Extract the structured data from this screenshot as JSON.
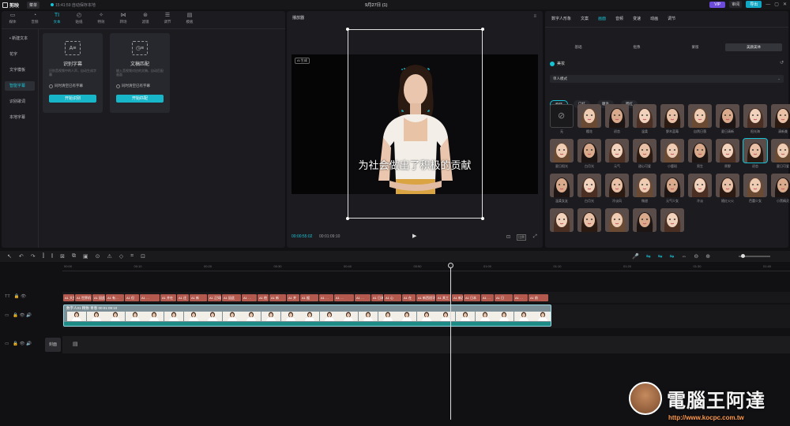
{
  "app": {
    "name": "剪映",
    "menu": "菜单",
    "autosave": "15:41:59 自动保存本地",
    "project_title": "9月27日 (1)",
    "vip": "VIP",
    "share": "审阅",
    "export": "导出",
    "min": "—",
    "max": "▢",
    "close": "✕"
  },
  "toolbar": {
    "tabs": [
      {
        "label": "媒体",
        "icon": "media-icon",
        "glyph": "▭"
      },
      {
        "label": "音频",
        "icon": "audio-icon",
        "glyph": "◔"
      },
      {
        "label": "文本",
        "icon": "text-icon",
        "glyph": "TI"
      },
      {
        "label": "贴纸",
        "icon": "sticker-icon",
        "glyph": "◴"
      },
      {
        "label": "特效",
        "icon": "effects-icon",
        "glyph": "✧"
      },
      {
        "label": "转场",
        "icon": "transition-icon",
        "glyph": "⋈"
      },
      {
        "label": "滤镜",
        "icon": "filter-icon",
        "glyph": "⊛"
      },
      {
        "label": "调节",
        "icon": "adjust-icon",
        "glyph": "☰"
      },
      {
        "label": "模板",
        "icon": "template-icon",
        "glyph": "▤"
      }
    ],
    "active": 2
  },
  "sidebar": {
    "items": [
      "• 新建文本",
      "花字",
      "文字模板",
      "智能字幕",
      "识别歌词",
      "本地字幕"
    ],
    "active": 3
  },
  "cards": [
    {
      "title": "识别字幕",
      "desc": "识别音视频中的人声，自动生成字幕",
      "check": "同时清空已有字幕",
      "button": "开始识别",
      "icon": "A≡"
    },
    {
      "title": "文稿匹配",
      "desc": "输入音视频对应的文稿，自动匹配画面",
      "check": "同时清空已有字幕",
      "button": "开始匹配",
      "icon": "◷≡"
    }
  ],
  "player": {
    "title": "播放器",
    "menu": "≡",
    "badge": "AI 生成",
    "subtitle": "为社会做出了积极的贡献",
    "current": "00:00:55:02",
    "total": "00:01:09:10",
    "play": "▶",
    "ratio": "比例"
  },
  "right": {
    "tabs": [
      "数字人形象",
      "文案",
      "画面",
      "音频",
      "变速",
      "动画",
      "调节"
    ],
    "active_tab": 2,
    "subtabs": [
      "基础",
      "抠像",
      "蒙版",
      "美颜美体"
    ],
    "active_sub": 3,
    "beauty": {
      "label": "美妆",
      "reset": "↺",
      "dropdown": "单人模式",
      "chips": [
        "套装",
        "口红",
        "睫毛",
        "腮红"
      ],
      "active_chip": 0
    },
    "thumbs": [
      "无",
      "樱花",
      "初恋",
      "温柔",
      "野木蓝莓",
      "自然日落",
      "夏日清新",
      "阳光海",
      "清新美",
      "夏日阳光",
      "白月光",
      "元气",
      "甜心可爱",
      "小鹿斑",
      "男生",
      "原野",
      "初恋",
      "夏日可爱",
      "温柔女友",
      "白月光",
      "冷淡风",
      "微甜",
      "元气少女",
      "冷淡",
      "随红火火",
      "芭蕾少女",
      "小黑精灵",
      "anime",
      "大气",
      "冬日清新",
      "学院派",
      "人物低胸"
    ],
    "selected_thumb": 16
  },
  "timeline": {
    "tools": [
      "↖",
      "↶",
      "↷",
      "⫿",
      "⫾",
      "⊠",
      "⧉",
      "▣",
      "⊙",
      "⚠",
      "◇",
      "⌗",
      "⊡"
    ],
    "right_tools": [
      "🎤",
      "⇋",
      "⇋",
      "⇋",
      "⇔",
      "⊖",
      "⊕"
    ],
    "ticks": [
      "00:00",
      "00:10",
      "00:20",
      "00:30",
      "00:40",
      "00:50",
      "01:00",
      "01:10",
      "01:20",
      "01:30",
      "01:40"
    ],
    "tracks": [
      {
        "label": "TT",
        "locks": "🔒 👁"
      },
      {
        "label": "▭",
        "locks": "🔒 👁 🔊"
      },
      {
        "label": "▭",
        "locks": "🔒 👁 🔊"
      }
    ],
    "text_clips": [
      "A1 大多",
      "A1 世界机",
      "A1 因此新",
      "A1 有…",
      "A1 但",
      "A1 …",
      "A1 并在",
      "A1 还",
      "A1 新",
      "A1 正如民",
      "A1 因此",
      "A1 …",
      "A1 他",
      "A1 新",
      "A1 并",
      "A1 据",
      "A1 …",
      "A1 …",
      "A1 …",
      "A1 日本",
      "A1 心",
      "A1 在",
      "A1 新西班牙",
      "A1 其工",
      "A1 新西兰",
      "A1 日本",
      "A1 …",
      "A1 日",
      "A1 …",
      "A1 前",
      "A1 …",
      "A1 在",
      "A1 不仅",
      "A1 …"
    ],
    "video_clip": "数字人01 精致·青春  00:01:09:10",
    "cover": "封面"
  },
  "watermark": {
    "text": "電腦王阿達",
    "url": "http://www.kocpc.com.tw"
  }
}
